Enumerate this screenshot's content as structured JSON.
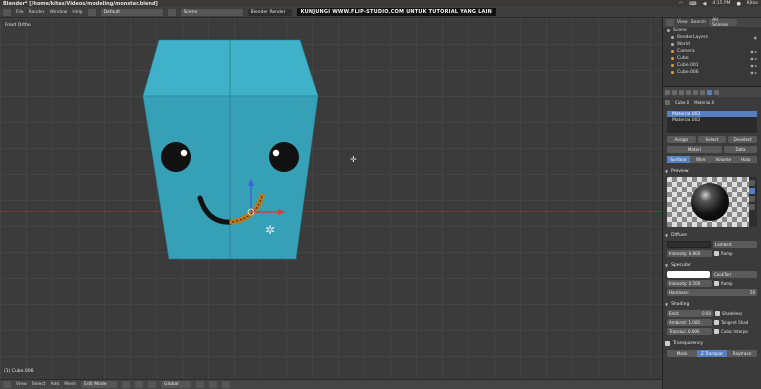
{
  "os": {
    "title": "Blender* [/home/kitas/Videos/modeling/monster.blend]",
    "clock": "4:15 PM",
    "user": "Kitas"
  },
  "info_header": {
    "menus": [
      "File",
      "Render",
      "Window",
      "Help"
    ],
    "layout": "Default",
    "scene": "Scene",
    "engine": "Blender Render",
    "banner": "KUNJUNGI WWW.FLIP-STUDIO.COM UNTUK TUTORIAL YANG LAIN"
  },
  "viewport": {
    "view_label": "Front Ortho",
    "object_label": "(1) Cube.006"
  },
  "view_header": {
    "menus": [
      "View",
      "Select",
      "Add",
      "Mesh"
    ],
    "mode": "Edit Mode",
    "pivot": "Global"
  },
  "outliner": {
    "header": [
      "View",
      "Search",
      "All Scenes"
    ],
    "items": [
      "Scene",
      "RenderLayers",
      "World",
      "Camera",
      "Cube",
      "Cube.001",
      "Cube.006"
    ]
  },
  "properties": {
    "object": "Cube.0",
    "material_name": "Material.0",
    "materials": [
      "Material.003",
      "Material.002"
    ],
    "buttons": [
      "Assign",
      "Select",
      "Deselect"
    ],
    "slot_row": [
      "Materi",
      "Data"
    ],
    "tabs": [
      "Surface",
      "Wire",
      "Volume",
      "Halo"
    ],
    "preview_label": "Preview",
    "diffuse": {
      "label": "Diffuse",
      "shader": "Lambert",
      "intensity": "Intensity: 0.800",
      "ramp": "Ramp",
      "color": "#2e2e2e"
    },
    "specular": {
      "label": "Specular",
      "shader": "CookTorr",
      "intensity": "Intensity: 0.500",
      "ramp": "Ramp",
      "hardness": "Hardness:",
      "hardness_val": "50",
      "color": "#ffffff"
    },
    "shading": {
      "label": "Shading",
      "emit": "Emit:",
      "emit_val": "0.00",
      "ambient": "Ambient: 1.000",
      "translucency": "Transluc: 0.000",
      "checks": [
        "Shadeless",
        "Tangent Shad",
        "Cubic Interpo"
      ]
    },
    "transparency": "Transparency",
    "bottom_tabs": [
      "Mask",
      "Z Transpar",
      "Raytrace"
    ]
  },
  "colors": {
    "cube": "#37a3ba",
    "accent": "#5680c2"
  }
}
